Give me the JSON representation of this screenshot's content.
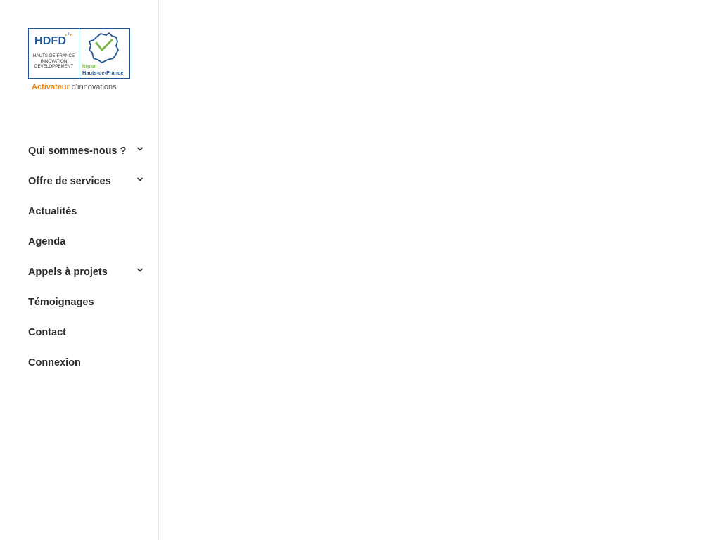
{
  "logo": {
    "hdfd_text": "HDFD",
    "subtitle_line1": "HAUTS-DE-FRANCE",
    "subtitle_line2": "INNOVATION",
    "subtitle_line3": "DEVELOPPEMENT",
    "region_label": "Région",
    "region_name": "Hauts-de-France",
    "tagline_strong": "Activateur",
    "tagline_rest": "d'innovations",
    "colors": {
      "blue": "#1f5596",
      "green": "#7ab648",
      "orange": "#e8861a"
    }
  },
  "nav": {
    "items": [
      {
        "label": "Qui sommes-nous ?",
        "has_submenu": true,
        "icon": "chevron-down-icon"
      },
      {
        "label": "Offre de services",
        "has_submenu": true,
        "icon": "chevron-down-icon"
      },
      {
        "label": "Actualités",
        "has_submenu": false
      },
      {
        "label": "Agenda",
        "has_submenu": false
      },
      {
        "label": "Appels à projets",
        "has_submenu": true,
        "icon": "chevron-down-icon"
      },
      {
        "label": "Témoignages",
        "has_submenu": false
      },
      {
        "label": "Contact",
        "has_submenu": false
      },
      {
        "label": "Connexion",
        "has_submenu": false
      }
    ]
  }
}
